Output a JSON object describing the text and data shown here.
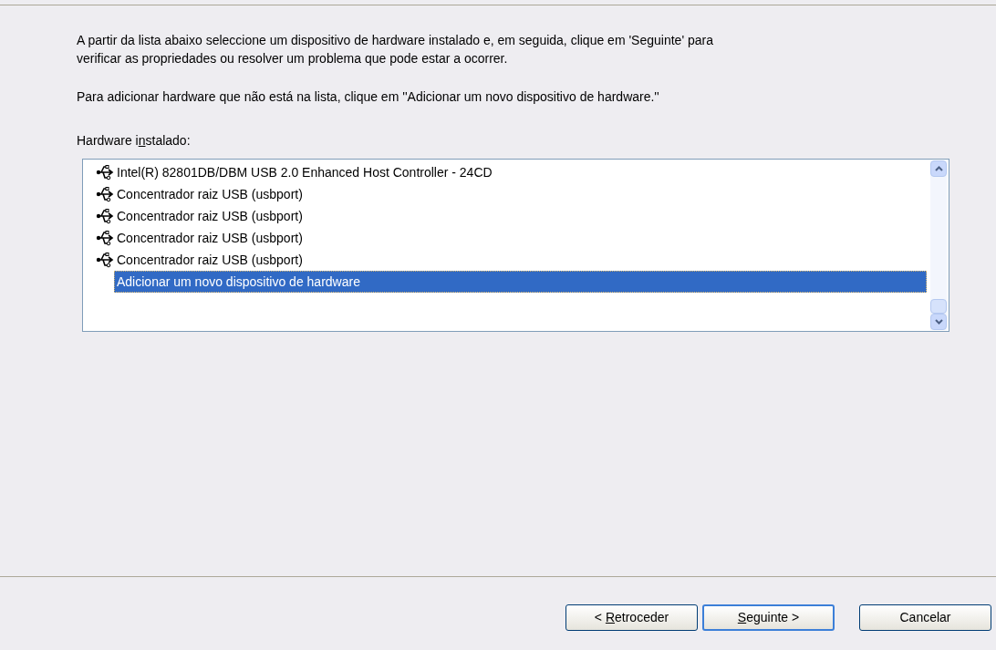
{
  "intro": "A partir da lista abaixo seleccione um dispositivo de hardware instalado e, em seguida, clique em 'Seguinte' para verificar as propriedades ou resolver um problema que pode estar a ocorrer.",
  "add_hint": "Para adicionar hardware que não está na lista, clique em ''Adicionar um novo dispositivo de hardware.''",
  "list_label": {
    "pre": "Hardware i",
    "key": "n",
    "post": "stalado:"
  },
  "items": [
    {
      "kind": "device",
      "label": "Intel(R) 82801DB/DBM USB 2.0 Enhanced Host Controller - 24CD",
      "selected": false
    },
    {
      "kind": "device",
      "label": "Concentrador raiz USB (usbport)",
      "selected": false
    },
    {
      "kind": "device",
      "label": "Concentrador raiz USB (usbport)",
      "selected": false
    },
    {
      "kind": "device",
      "label": "Concentrador raiz USB (usbport)",
      "selected": false
    },
    {
      "kind": "device",
      "label": "Concentrador raiz USB (usbport)",
      "selected": false
    },
    {
      "kind": "add",
      "label": "Adicionar um novo dispositivo de hardware",
      "selected": true
    }
  ],
  "buttons": [
    {
      "parts": {
        "pre": "< ",
        "key": "R",
        "post": "etroceder"
      },
      "default": false
    },
    {
      "parts": {
        "key": "S",
        "post": "eguinte >"
      },
      "default": true
    },
    {
      "parts": {
        "pre": "Cancelar"
      },
      "default": false
    }
  ]
}
